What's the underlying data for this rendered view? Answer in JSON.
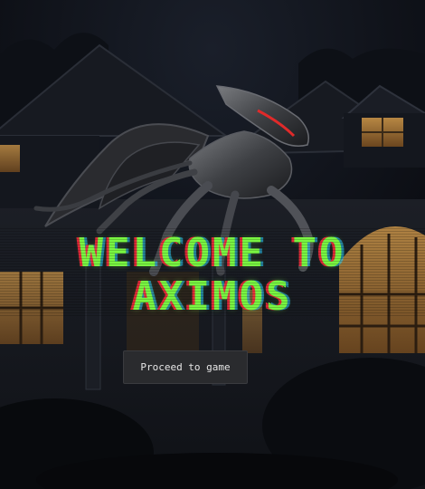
{
  "screen": {
    "title_line_1": "WELCOME TO",
    "title_line_2": "AXIMOS",
    "proceed_label": "Proceed to game"
  },
  "colors": {
    "title_green": "#79f542",
    "title_red_fringe": "#ff283c",
    "button_bg": "#2a2b2e",
    "night_sky": "#0b0d12",
    "window_glow": "#c58a3c"
  }
}
